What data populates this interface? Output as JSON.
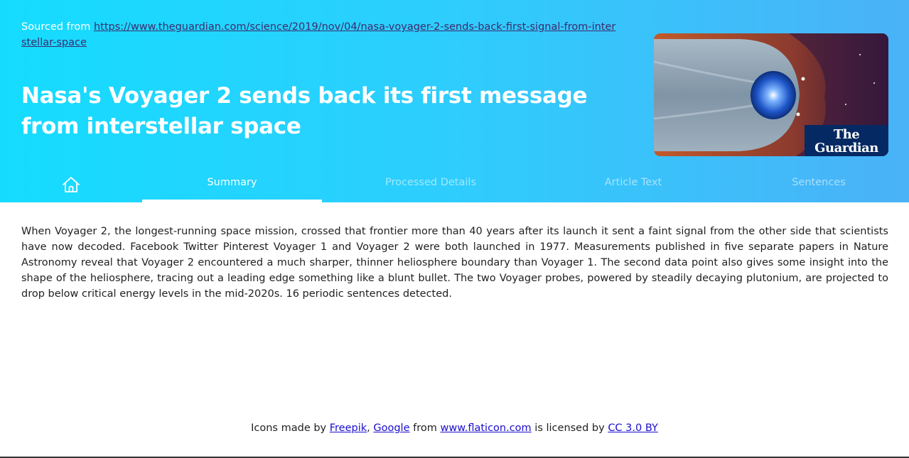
{
  "header": {
    "source_prefix": "Sourced from",
    "source_url": "https://www.theguardian.com/science/2019/nov/04/nasa-voyager-2-sends-back-first-signal-from-interstellar-space",
    "title": "Nasa's Voyager 2 sends back its first message from interstellar space",
    "logo_line1": "The",
    "logo_line2": "Guardian"
  },
  "nav": {
    "home_icon": "home-icon",
    "tabs": [
      {
        "label": "Summary",
        "active": true
      },
      {
        "label": "Processed Details",
        "active": false
      },
      {
        "label": "Article Text",
        "active": false
      },
      {
        "label": "Sentences",
        "active": false
      }
    ]
  },
  "summary": {
    "text": "When Voyager 2, the longest-running space mission, crossed that frontier more than 40 years after its launch it sent a faint signal from the other side that scientists have now decoded. Facebook Twitter Pinterest Voyager 1 and Voyager 2 were both launched in 1977. Measurements published in five separate papers in Nature Astronomy reveal that Voyager 2 encountered a much sharper, thinner heliosphere boundary than Voyager 1. The second data point also gives some insight into the shape of the heliosphere, tracing out a leading edge something like a blunt bullet. The two Voyager probes, powered by steadily decaying plutonium, are projected to drop below critical energy levels in the mid-2020s. 16 periodic sentences detected."
  },
  "footer": {
    "prefix": "Icons made by",
    "link1": "Freepik",
    "sep": ",",
    "link2": "Google",
    "mid1": "from",
    "link3": "www.flaticon.com",
    "mid2": "is licensed by",
    "link4": "CC 3.0 BY"
  },
  "colors": {
    "header_start": "#15dcff",
    "header_end": "#4ab2f7",
    "link_dark": "#3c2a6b",
    "footer_link": "#1a0dcc",
    "guardian_blue": "#052962"
  }
}
